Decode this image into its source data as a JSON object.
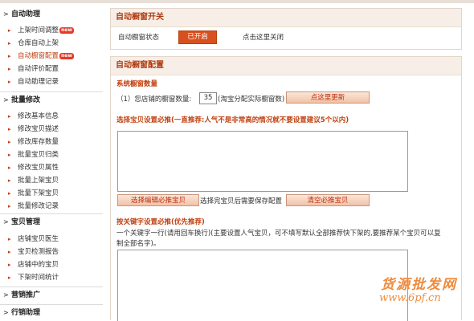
{
  "sidebar": {
    "sections": [
      {
        "title": "自动助理",
        "items": [
          {
            "label": "上架时间调整",
            "badge": "new"
          },
          {
            "label": "仓库自动上架"
          },
          {
            "label": "自动橱窗配置",
            "badge": "new",
            "active": true
          },
          {
            "label": "自动评价配置"
          },
          {
            "label": "自动助理记录"
          }
        ]
      },
      {
        "title": "批量修改",
        "items": [
          {
            "label": "修改基本信息"
          },
          {
            "label": "修改宝贝描述"
          },
          {
            "label": "修改库存数量"
          },
          {
            "label": "批量宝贝归类"
          },
          {
            "label": "修改宝贝属性"
          },
          {
            "label": "批量上架宝贝"
          },
          {
            "label": "批量下架宝贝"
          },
          {
            "label": "批量修改记录"
          }
        ]
      },
      {
        "title": "宝贝管理",
        "items": [
          {
            "label": "店铺宝贝医生"
          },
          {
            "label": "宝贝检测报告"
          },
          {
            "label": "店铺中的宝贝"
          },
          {
            "label": "下架时间统计"
          }
        ]
      },
      {
        "title": "营销推广",
        "items": []
      },
      {
        "title": "行销助理",
        "items": []
      }
    ]
  },
  "switch_panel": {
    "title": "自动橱窗开关",
    "status_label": "自动橱窗状态",
    "toggle_label": "已开启",
    "close_link": "点击这里关闭"
  },
  "config_panel": {
    "title": "自动橱窗配置",
    "count_section_title": "系统橱窗数量",
    "count_prefix": "（1）您店铺的橱窗数量:",
    "count_value": "35",
    "count_suffix": "(淘宝分配实际橱窗数)",
    "update_button": "点这里更新",
    "must_section_title": "选择宝贝设置必推(一直推荐:人气不是非常高的情况就不要设置建议5个以内)",
    "select_button": "选择编辑必推宝贝",
    "save_hint": "选择完宝贝后需要保存配置",
    "clear_button": "清空必推宝贝",
    "keyword_section_title": "按关键字设置必推(优先推荐)",
    "keyword_desc_1": "一个关键字一行(请用回车换行)(主要设置人气宝贝，可不填写默认全部推荐快下架的,要推荐某个宝贝可以复",
    "keyword_desc_2": "制全部名字)。"
  },
  "watermark": {
    "text": "货源批发网",
    "url": "www.6pf.cn"
  },
  "colors": {
    "accent": "#c04010",
    "toggle_bg": "#d9501f",
    "panel_head_bg": "#f7efe7",
    "watermark": "#f08a3c"
  }
}
